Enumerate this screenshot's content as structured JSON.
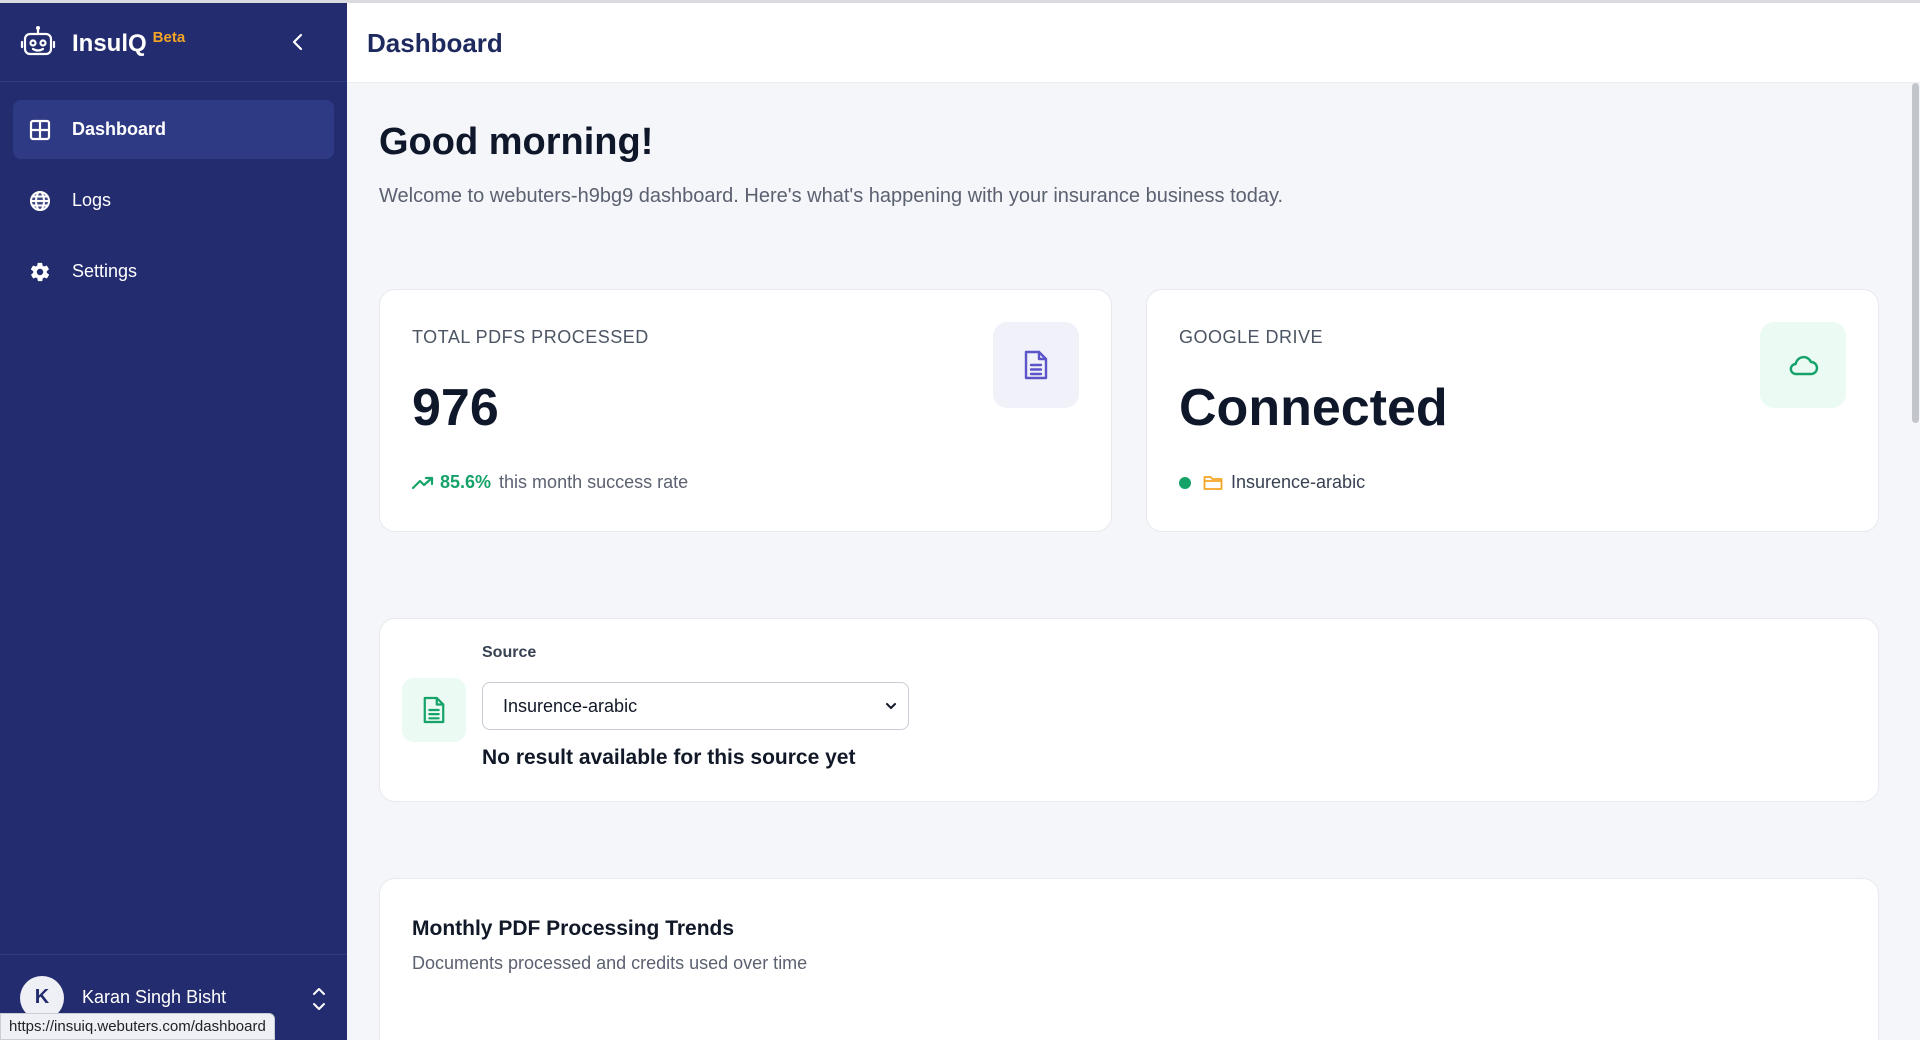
{
  "brand": {
    "name": "InsulQ",
    "badge": "Beta"
  },
  "sidebar": {
    "items": [
      {
        "label": "Dashboard",
        "icon": "grid-icon",
        "active": true
      },
      {
        "label": "Logs",
        "icon": "globe-icon",
        "active": false
      },
      {
        "label": "Settings",
        "icon": "gear-icon",
        "active": false
      }
    ]
  },
  "user": {
    "initial": "K",
    "name": "Karan Singh Bisht"
  },
  "status_bar": {
    "url": "https://insuiq.webuters.com/dashboard"
  },
  "header": {
    "title": "Dashboard"
  },
  "main": {
    "greeting": "Good morning!",
    "welcome": "Welcome to webuters-h9bg9 dashboard. Here's what's happening with your insurance business today."
  },
  "stats": {
    "pdfs": {
      "label": "TOTAL PDFS PROCESSED",
      "value": "976",
      "rate": "85.6%",
      "rate_text": "this month success rate"
    },
    "drive": {
      "label": "GOOGLE DRIVE",
      "value": "Connected",
      "folder": "Insurence-arabic"
    }
  },
  "source": {
    "label": "Source",
    "selected": "Insurence-arabic",
    "message": "No result available for this source yet"
  },
  "trends": {
    "title": "Monthly PDF Processing Trends",
    "subtitle": "Documents processed and credits used over time"
  },
  "colors": {
    "sidebar_bg": "#232c6e",
    "accent_beta": "#f5a524",
    "success": "#16a36a",
    "icon_purple": "#5b55c9"
  }
}
